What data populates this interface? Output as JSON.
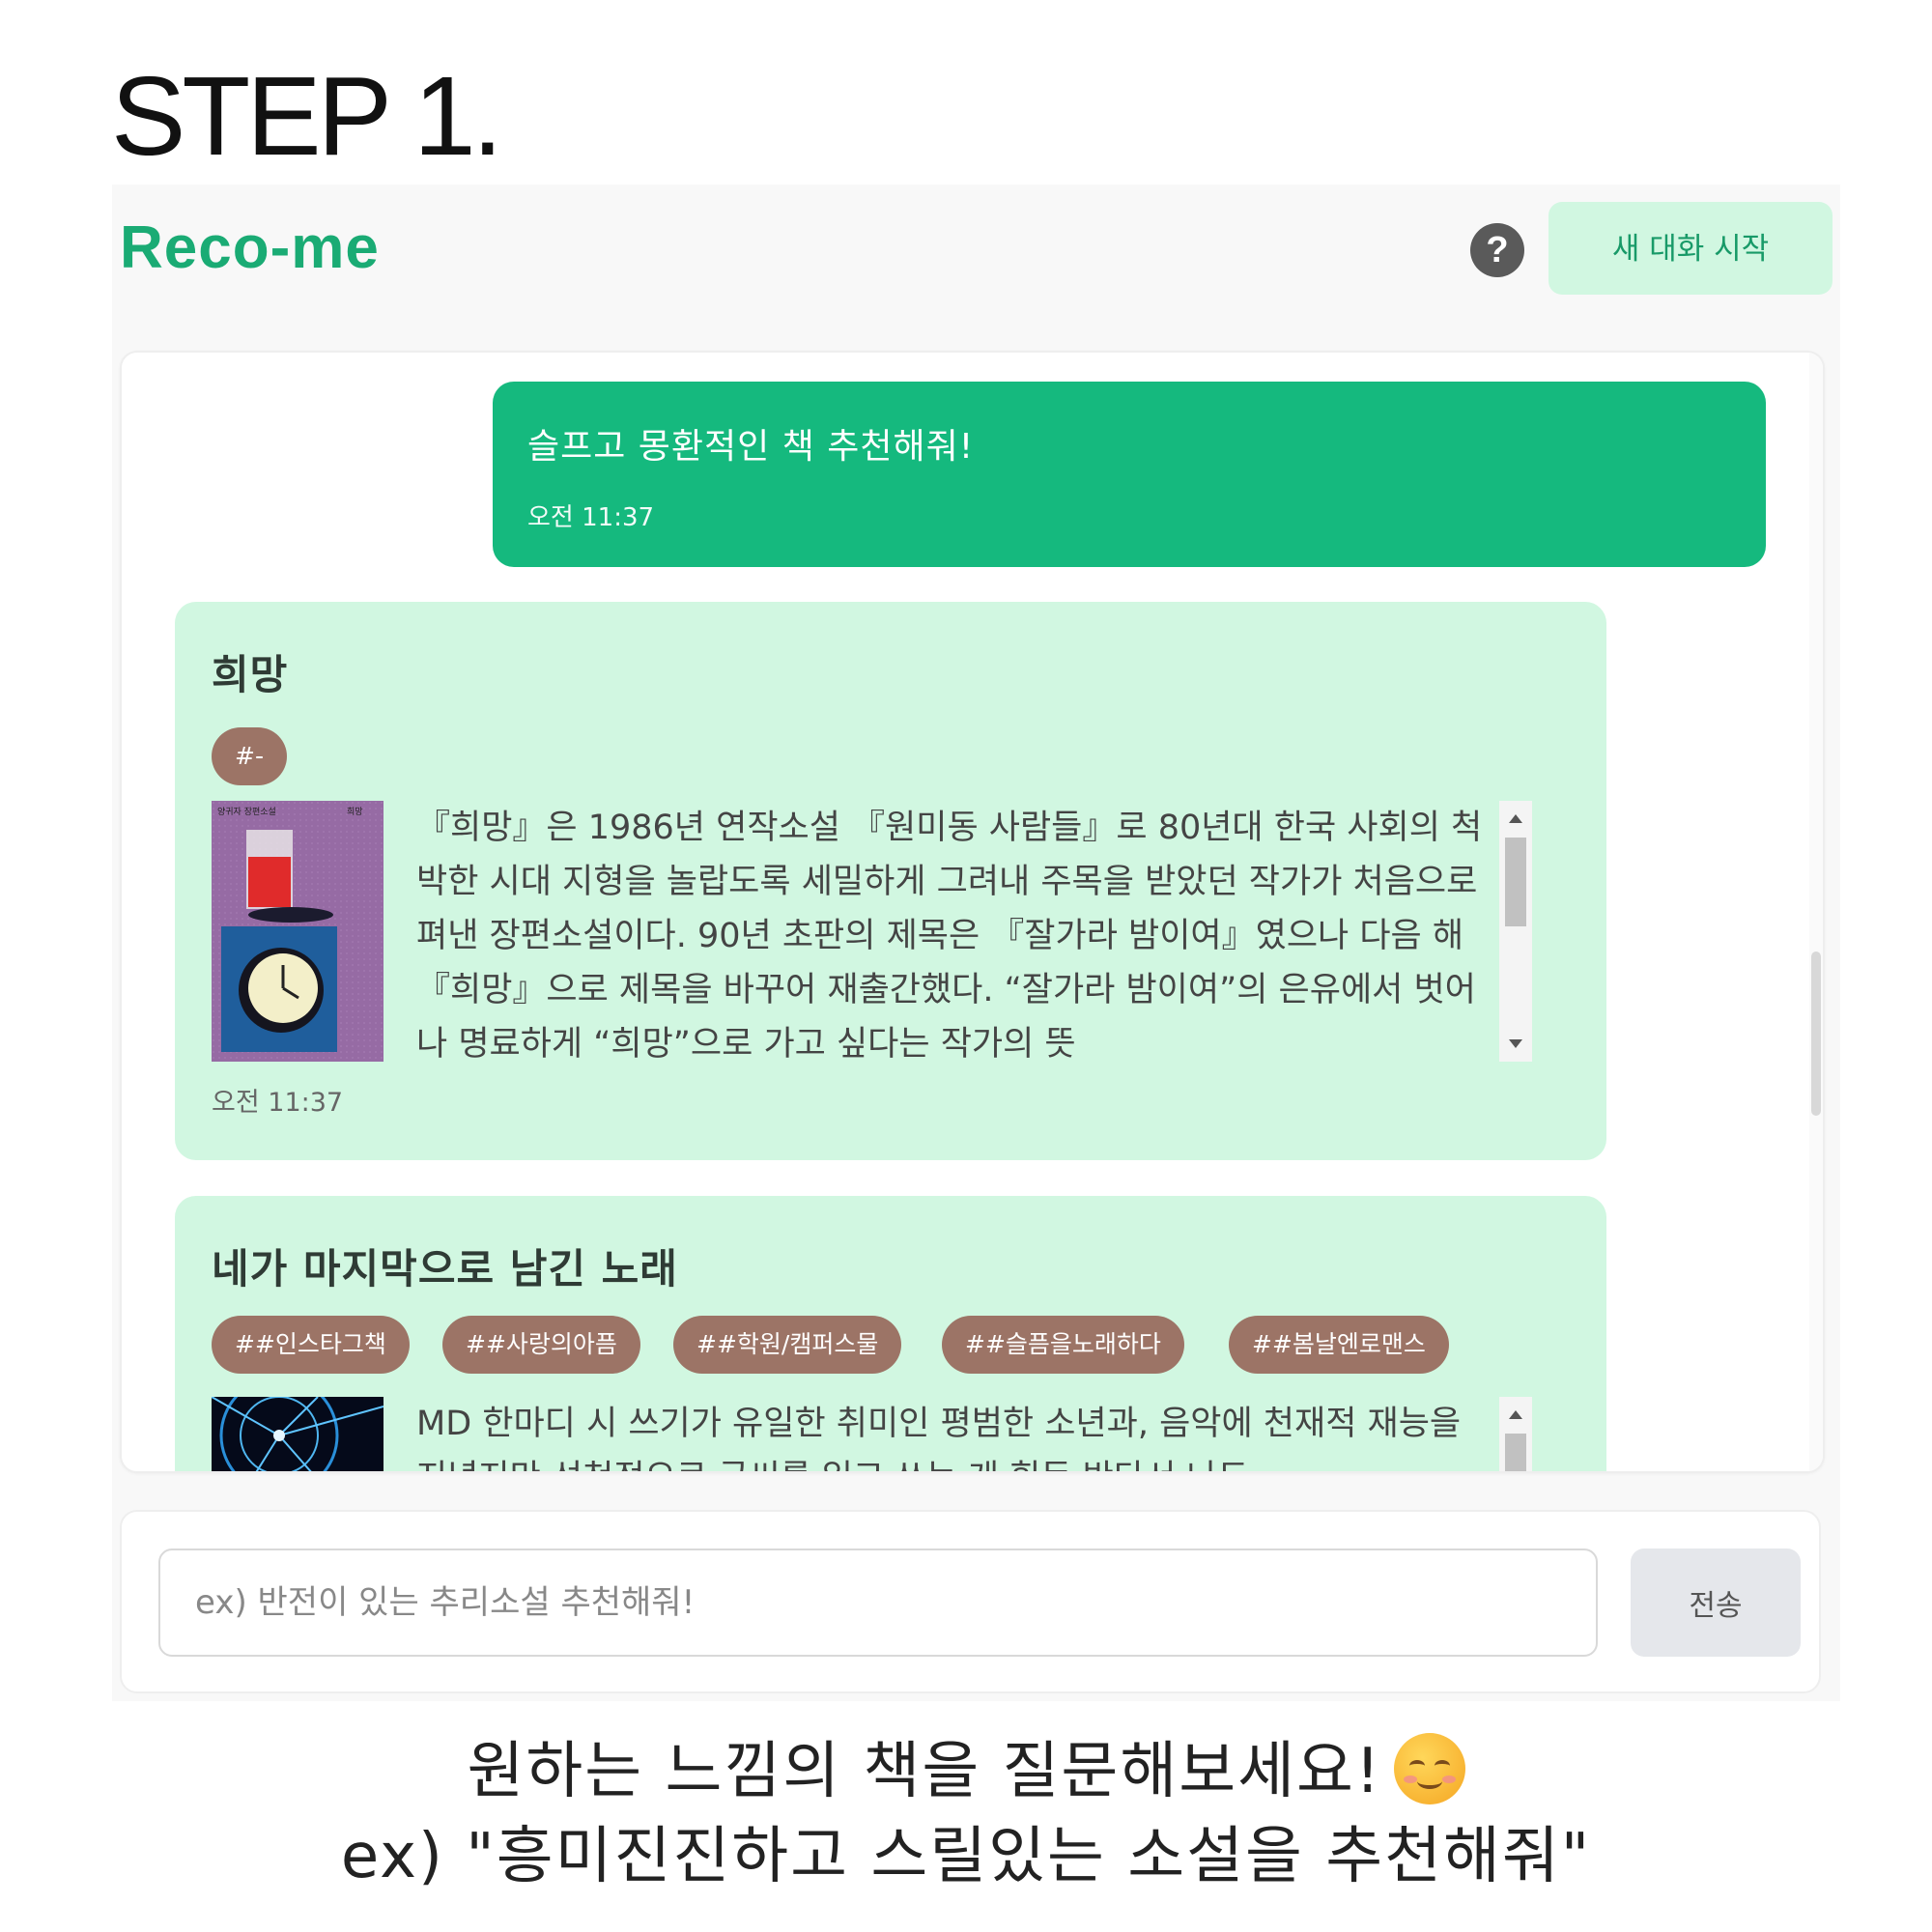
{
  "step_title": "STEP 1.",
  "app": {
    "brand": "Reco-me",
    "help_icon_glyph": "?",
    "new_chat_label": "새 대화 시작",
    "accent_color": "#15b97e",
    "card_color": "#d1f7e1",
    "tag_color": "#9c7466"
  },
  "user_message": {
    "text": "슬프고 몽환적인 책 추천해줘!",
    "time": "오전 11:37"
  },
  "books": [
    {
      "title": "희망",
      "tags": [
        "#-"
      ],
      "description": "『희망』은 1986년 연작소설 『원미동 사람들』로 80년대 한국 사회의 척박한 시대 지형을 놀랍도록 세밀하게 그려내 주목을 받았던 작가가 처음으로 펴낸 장편소설이다. 90년 초판의 제목은 『잘가라 밤이여』였으나 다음 해 『희망』으로 제목을 바꾸어 재출간했다. “잘가라 밤이여”의 은유에서 벗어나 명료하게 “희망”으로 가고 싶다는 작가의 뜻",
      "time": "오전 11:37",
      "cover_author": "양귀자 장편소설",
      "cover_title": "희망"
    },
    {
      "title": "네가 마지막으로 남긴 노래",
      "tags": [
        "##인스타그책",
        "##사랑의아픔",
        "##학원/캠퍼스물",
        "##슬픔을노래하다",
        "##봄날엔로맨스"
      ],
      "description": "MD 한마디 시 쓰기가 유일한 취미인 평범한 소년과, 음악에 천재적 재능을 지녔지만 선천적으로 글씨를 읽고 쓰는 게 힘든 반다서 나도"
    }
  ],
  "input": {
    "placeholder": "ex) 반전이 있는 추리소설 추천해줘!",
    "send_label": "전송"
  },
  "captions": {
    "line1": "원하는 느낌의 책을 질문해보세요!",
    "line2": "ex) \"흥미진진하고 스릴있는 소설을 추천해줘\""
  }
}
